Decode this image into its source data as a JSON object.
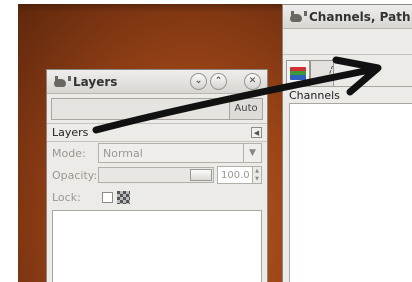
{
  "colors": {
    "wallpaper": "#9a4416",
    "window_bg": "#ecebe8",
    "arrow": "#111111"
  },
  "layers_dialog": {
    "title": "Layers",
    "auto_button_label": "Auto",
    "tab_label": "Layers",
    "mode_label": "Mode:",
    "mode_value": "Normal",
    "opacity_label": "Opacity:",
    "opacity_value": "100.0",
    "lock_label": "Lock:",
    "icons": {
      "title": "wilber-icon",
      "minimize": "chevron-down-icon",
      "maximize": "chevron-up-icon",
      "close": "close-icon",
      "tab_menu": "tab-menu-icon",
      "mode_dropdown": "dropdown-arrow-icon"
    }
  },
  "channels_dialog": {
    "title": "Channels, Path",
    "tab_label": "Channels",
    "tabs": [
      {
        "icon": "layers-stack-icon",
        "active": true
      },
      {
        "icon": "paths-icon",
        "active": false
      }
    ]
  },
  "annotation": {
    "type": "arrow",
    "from": "layers-tab",
    "to": "channels-tab-bar"
  }
}
